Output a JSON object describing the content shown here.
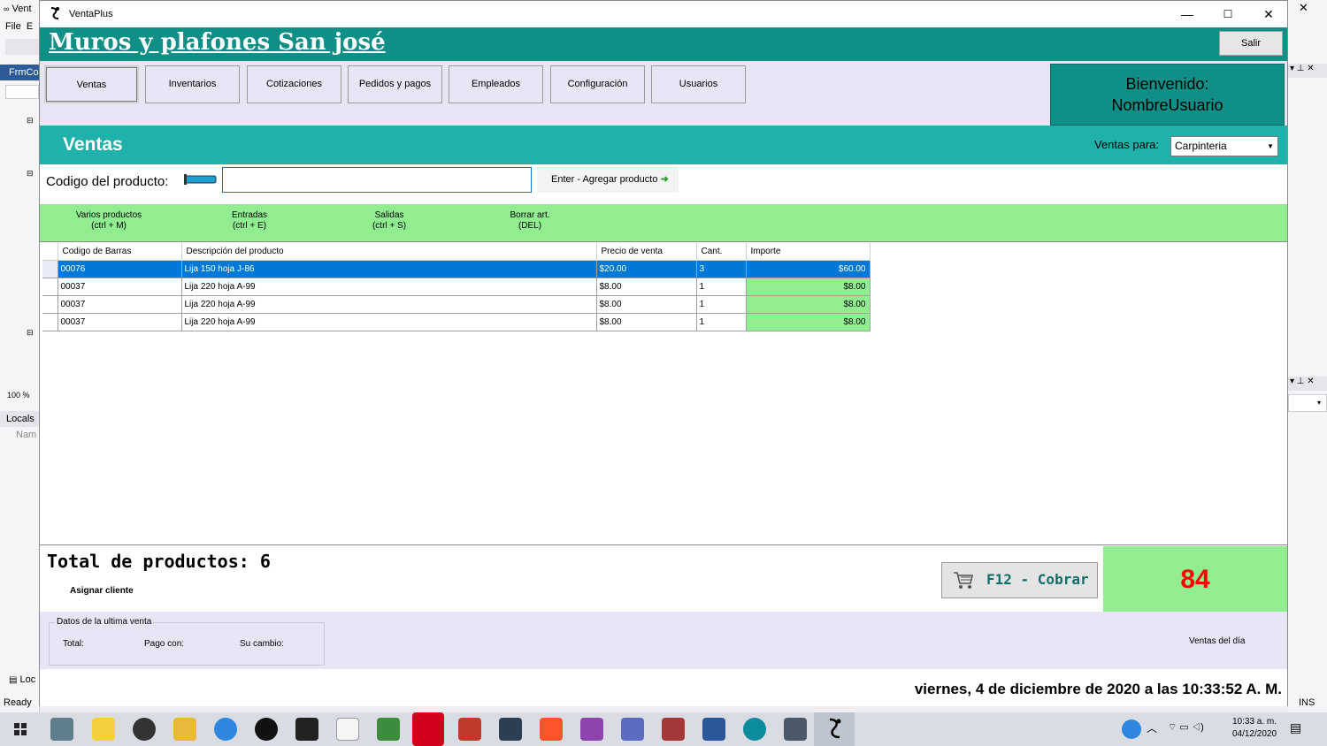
{
  "background_ide": {
    "left_tab": "Vent",
    "menu_file": "File",
    "menu_edit": "E",
    "doc_tab": "FrmCo",
    "zoom": "100 %",
    "locals_tab": "Locals",
    "name_col": "Nam",
    "loc_tab": "Loc",
    "status": "Ready",
    "status_ins": "INS"
  },
  "window": {
    "title": "VentaPlus",
    "minimize": "—",
    "maximize": "☐",
    "close": "✕"
  },
  "brand": {
    "title": "Muros y plafones San josé",
    "exit_label": "Salir"
  },
  "nav": {
    "items": [
      {
        "label": "Ventas"
      },
      {
        "label": "Inventarios"
      },
      {
        "label": "Cotizaciones"
      },
      {
        "label": "Pedidos y pagos"
      },
      {
        "label": "Empleados"
      },
      {
        "label": "Configuración"
      },
      {
        "label": "Usuarios"
      }
    ],
    "welcome_line1": "Bienvenido:",
    "welcome_line2": "NombreUsuario"
  },
  "section": {
    "title": "Ventas",
    "ventas_para_label": "Ventas para:",
    "ventas_para_value": "Carpinteria"
  },
  "code_entry": {
    "label": "Codigo del producto:",
    "value": "",
    "add_label": "Enter - Agregar producto"
  },
  "shortcuts": [
    {
      "line1": "Varios productos",
      "line2": "(ctrl + M)"
    },
    {
      "line1": "Entradas",
      "line2": "(ctrl + E)"
    },
    {
      "line1": "Salidas",
      "line2": "(ctrl + S)"
    },
    {
      "line1": "Borrar art.",
      "line2": "(DEL)"
    }
  ],
  "grid": {
    "headers": [
      "Codigo de Barras",
      "Descripción del producto",
      "Precio de venta",
      "Cant.",
      "Importe"
    ],
    "rows": [
      {
        "code": "00076",
        "desc": "Lija 150 hoja J-86",
        "price": "$20.00",
        "qty": "3",
        "amount": "$60.00"
      },
      {
        "code": "00037",
        "desc": "Lija 220 hoja A-99",
        "price": "$8.00",
        "qty": "1",
        "amount": "$8.00"
      },
      {
        "code": "00037",
        "desc": "Lija 220 hoja A-99",
        "price": "$8.00",
        "qty": "1",
        "amount": "$8.00"
      },
      {
        "code": "00037",
        "desc": "Lija 220 hoja A-99",
        "price": "$8.00",
        "qty": "1",
        "amount": "$8.00"
      }
    ]
  },
  "summary": {
    "total_products": "Total de productos: 6",
    "assign_client": "Asignar cliente",
    "cobrar_label": "F12 - Cobrar",
    "total_value": "84"
  },
  "last_sale": {
    "legend": "Datos de la ultima venta",
    "total_label": "Total:",
    "paid_label": "Pago con:",
    "change_label": "Su cambio:",
    "ventas_dia": "Ventas del día"
  },
  "datetime": "viernes, 4 de diciembre de 2020 a las 10:33:52 A. M.",
  "tray": {
    "time": "10:33 a. m.",
    "date": "04/12/2020"
  },
  "colors": {
    "brand": "#0f8f85",
    "section": "#20b2aa",
    "green": "#90ee90",
    "selected": "#0078d7",
    "total_red": "#ff0000"
  }
}
